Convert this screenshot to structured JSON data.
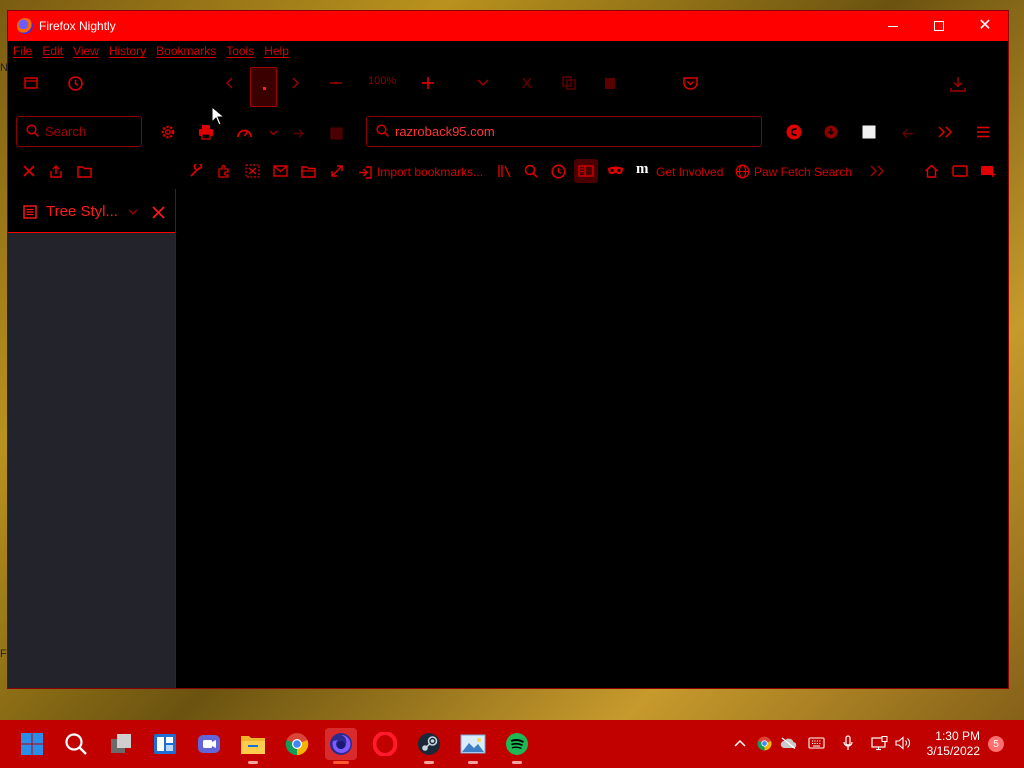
{
  "window": {
    "title": "Firefox Nightly"
  },
  "menubar": {
    "items": [
      "File",
      "Edit",
      "View",
      "History",
      "Bookmarks",
      "Tools",
      "Help"
    ]
  },
  "toolbar": {
    "zoom_level": "100%"
  },
  "search": {
    "placeholder": "Search"
  },
  "urlbar": {
    "value": "razroback95.com"
  },
  "bookmarks": {
    "import_label": "Import bookmarks...",
    "get_involved_label": "Get Involved",
    "paw_fetch_label": "Paw Fetch Search"
  },
  "sidebar": {
    "title": "Tree Styl..."
  },
  "taskbar": {
    "time": "1:30 PM",
    "date": "3/15/2022",
    "notification_count": "5"
  },
  "theme": {
    "accent": "#ff0000",
    "text_red": "#d40000",
    "background": "#000000",
    "sidebar_panel": "#23232b",
    "taskbar": "#c10000"
  }
}
